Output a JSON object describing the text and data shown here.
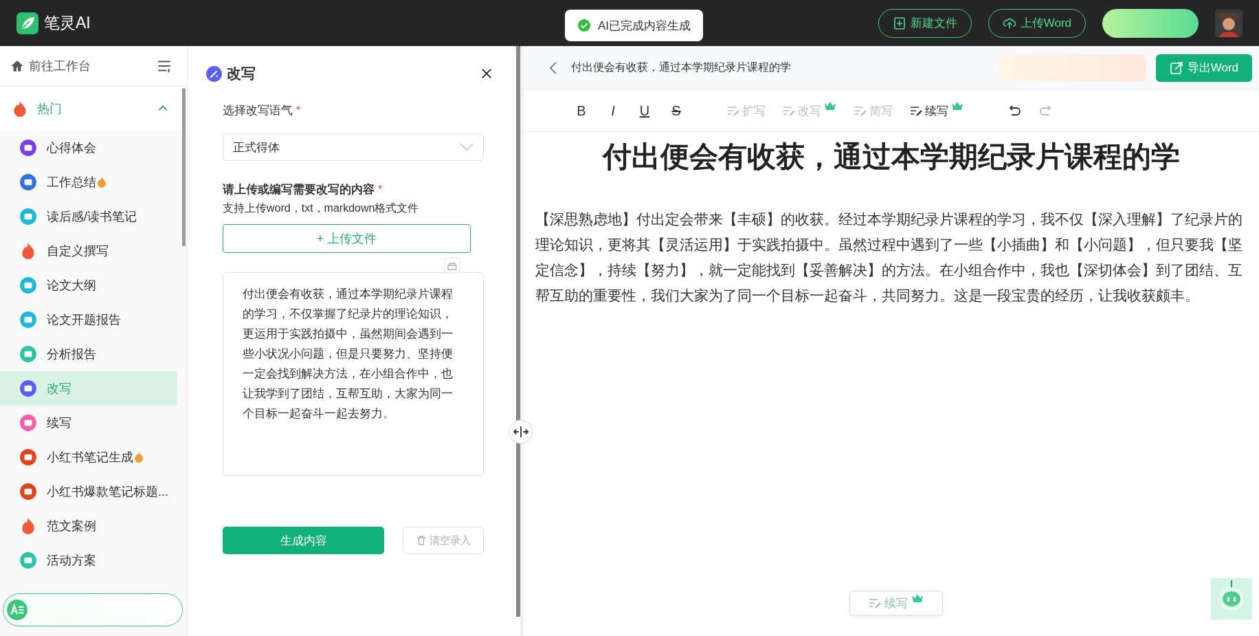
{
  "app": {
    "name": "笔灵AI"
  },
  "toast": {
    "text": "AI已完成内容生成"
  },
  "header_actions": [
    {
      "label": "新建文件",
      "kind": "new"
    },
    {
      "label": "上传Word",
      "kind": "upload"
    }
  ],
  "sidebar": {
    "home": "前往工作台",
    "group": {
      "label": "热门",
      "expanded": true
    },
    "items": [
      {
        "label": "心得体会",
        "kind": "badge",
        "color": "#7b3fe4",
        "hot": false,
        "selected": false
      },
      {
        "label": "工作总结",
        "kind": "badge",
        "color": "#2f6fe0",
        "hot": true,
        "selected": false
      },
      {
        "label": "读后感/读书笔记",
        "kind": "badge",
        "color": "#1fb9d8",
        "hot": false,
        "selected": false
      },
      {
        "label": "自定义撰写",
        "kind": "flame",
        "color": "#f0593a",
        "hot": false,
        "selected": false
      },
      {
        "label": "论文大纲",
        "kind": "badge",
        "color": "#1fb9d8",
        "hot": false,
        "selected": false
      },
      {
        "label": "论文开题报告",
        "kind": "badge",
        "color": "#1fb9d8",
        "hot": false,
        "selected": false
      },
      {
        "label": "分析报告",
        "kind": "badge",
        "color": "#2cc4a8",
        "hot": false,
        "selected": false
      },
      {
        "label": "改写",
        "kind": "badge",
        "color": "#5a5ef0",
        "hot": false,
        "selected": true
      },
      {
        "label": "续写",
        "kind": "badge",
        "color": "#f05fa8",
        "hot": false,
        "selected": false
      },
      {
        "label": "小红书笔记生成",
        "kind": "badge",
        "color": "#e0441c",
        "hot": true,
        "selected": false
      },
      {
        "label": "小红书爆款笔记标题...",
        "kind": "badge",
        "color": "#e0441c",
        "hot": false,
        "selected": false
      },
      {
        "label": "范文案例",
        "kind": "flame",
        "color": "#f0593a",
        "hot": false,
        "selected": false
      },
      {
        "label": "活动方案",
        "kind": "badge",
        "color": "#2cc4a8",
        "hot": false,
        "selected": false
      }
    ]
  },
  "panel": {
    "title": "改写",
    "tone_label": "选择改写语气",
    "required_mark": "*",
    "tone_value": "正式得体",
    "content_label": "请上传或编写需要改写的内容",
    "content_hint": "支持上传word，txt，markdown格式文件",
    "upload_button": "+ 上传文件",
    "content": "付出便会有收获，通过本学期纪录片课程的学习，不仅掌握了纪录片的理论知识，更运用于实践拍摄中，虽然期间会遇到一些小状况小问题，但是只要努力、坚持便一定会找到解决方法，在小组合作中，也让我学到了团结，互帮互助，大家为同一个目标一起奋斗一起去努力。",
    "generate_button": "生成内容",
    "clear_button": "清空录入"
  },
  "editor": {
    "doc_title": "付出便会有收获，通过本学期纪录片课程的学",
    "export_button": "导出Word",
    "toolbar": [
      {
        "kind": "bold",
        "label": "B",
        "disabled": false
      },
      {
        "kind": "italic",
        "label": "I",
        "disabled": false
      },
      {
        "kind": "underline",
        "label": "U",
        "disabled": false
      },
      {
        "kind": "strike",
        "label": "S",
        "disabled": false
      },
      {
        "kind": "expand",
        "label": "扩写",
        "disabled": true,
        "premium": false
      },
      {
        "kind": "rewrite",
        "label": "改写",
        "disabled": true,
        "premium": true
      },
      {
        "kind": "shorten",
        "label": "简写",
        "disabled": true,
        "premium": false
      },
      {
        "kind": "continue",
        "label": "续写",
        "disabled": false,
        "premium": true
      },
      {
        "kind": "undo",
        "disabled": false
      },
      {
        "kind": "redo",
        "disabled": true
      }
    ],
    "heading": "付出便会有收获，通过本学期纪录片课程的学",
    "paragraph": "【深思熟虑地】付出定会带来【丰硕】的收获。经过本学期纪录片课程的学习，我不仅【深入理解】了纪录片的理论知识，更将其【灵活运用】于实践拍摄中。虽然过程中遇到了一些【小插曲】和【小问题】，但只要我【坚定信念】，持续【努力】，就一定能找到【妥善解决】的方法。在小组合作中，我也【深切体会】到了团结、互帮互助的重要性，我们大家为了同一个目标一起奋斗，共同努力。这是一段宝贵的经历，让我收获颇丰。",
    "float_button": "续写"
  }
}
